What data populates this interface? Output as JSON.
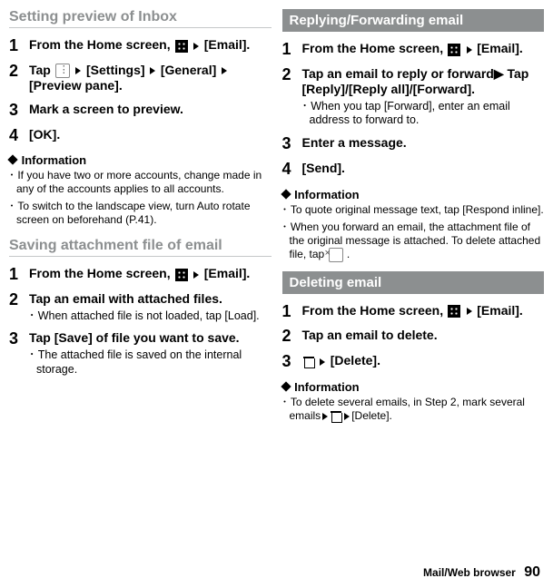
{
  "left": {
    "heading1": "Setting preview of Inbox",
    "s1": {
      "steps": [
        {
          "n": "1",
          "bold_pre": "From the Home screen, ",
          "bold_post": "[Email]."
        },
        {
          "n": "2",
          "bold": "Tap  ▶[Settings]▶[General]▶[Preview pane]."
        },
        {
          "n": "3",
          "bold": "Mark a screen to preview."
        },
        {
          "n": "4",
          "bold": "[OK]."
        }
      ],
      "info_title": "Information",
      "info": [
        "If you have two or more accounts, change made in any of the accounts applies to all accounts.",
        "To switch to the landscape view, turn Auto rotate screen on beforehand (P.41)."
      ]
    },
    "heading2": "Saving attachment file of email",
    "s2": {
      "steps": [
        {
          "n": "1",
          "bold_pre": "From the Home screen, ",
          "bold_post": "[Email]."
        },
        {
          "n": "2",
          "bold": "Tap an email with attached files.",
          "sub": "When attached file is not loaded, tap [Load]."
        },
        {
          "n": "3",
          "bold": "Tap [Save] of file you want to save.",
          "sub": "The attached file is saved on the internal storage."
        }
      ]
    }
  },
  "right": {
    "headingA": "Replying/Forwarding email",
    "sa": {
      "steps": [
        {
          "n": "1",
          "bold_pre": "From the Home screen, ",
          "bold_post": "[Email]."
        },
        {
          "n": "2",
          "bold": "Tap an email to reply or forward▶ Tap [Reply]/[Reply all]/[Forward].",
          "sub": "When you tap [Forward], enter an email address to forward to."
        },
        {
          "n": "3",
          "bold": "Enter a message."
        },
        {
          "n": "4",
          "bold": "[Send]."
        }
      ],
      "info_title": "Information",
      "info": [
        "To quote original message text, tap [Respond inline].",
        "When you forward an email, the attachment file of the original message is attached. To delete attached file, tap  ."
      ]
    },
    "headingB": "Deleting email",
    "sb": {
      "steps": [
        {
          "n": "1",
          "bold_pre": "From the Home screen, ",
          "bold_post": "[Email]."
        },
        {
          "n": "2",
          "bold": "Tap an email to delete."
        },
        {
          "n": "3",
          "bold_post": "[Delete]."
        }
      ],
      "info_title": "Information",
      "info": [
        "To delete several emails, in Step 2, mark several emails▶ ▶[Delete]."
      ]
    }
  },
  "footer": {
    "section": "Mail/Web browser",
    "page": "90"
  }
}
